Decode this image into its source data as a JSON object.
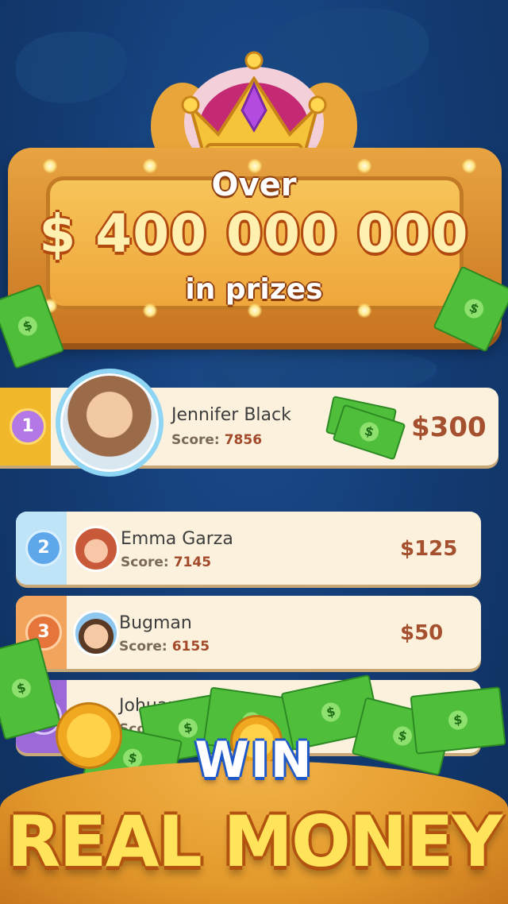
{
  "banner": {
    "over_label": "Over",
    "amount": "$ 400 000 000",
    "in_prizes": "in prizes"
  },
  "leaderboard": [
    {
      "rank": "1",
      "name": "Jennifer Black",
      "score_label": "Score:",
      "score": "7856",
      "prize": "$300"
    },
    {
      "rank": "2",
      "name": "Emma Garza",
      "score_label": "Score:",
      "score": "7145",
      "prize": "$125"
    },
    {
      "rank": "3",
      "name": "Bugman",
      "score_label": "Score:",
      "score": "6155",
      "prize": "$50"
    },
    {
      "rank": "6",
      "name": "Johuan",
      "score_label": "Score:",
      "score": "",
      "prize": ""
    }
  ],
  "footer": {
    "win": "WIN",
    "real_money": "REAL MONEY"
  },
  "colors": {
    "background": "#143e78",
    "sign": "#eea53a",
    "row": "#fbf1dd",
    "gold_strip": "#f1b82c",
    "silver_strip": "#bfe3f7",
    "bronze_strip": "#f2a45d",
    "purple_strip": "#9b6ad8",
    "prize_text": "#a5502f",
    "win_outline": "#1f58c8",
    "money_text": "#ffe35a"
  }
}
